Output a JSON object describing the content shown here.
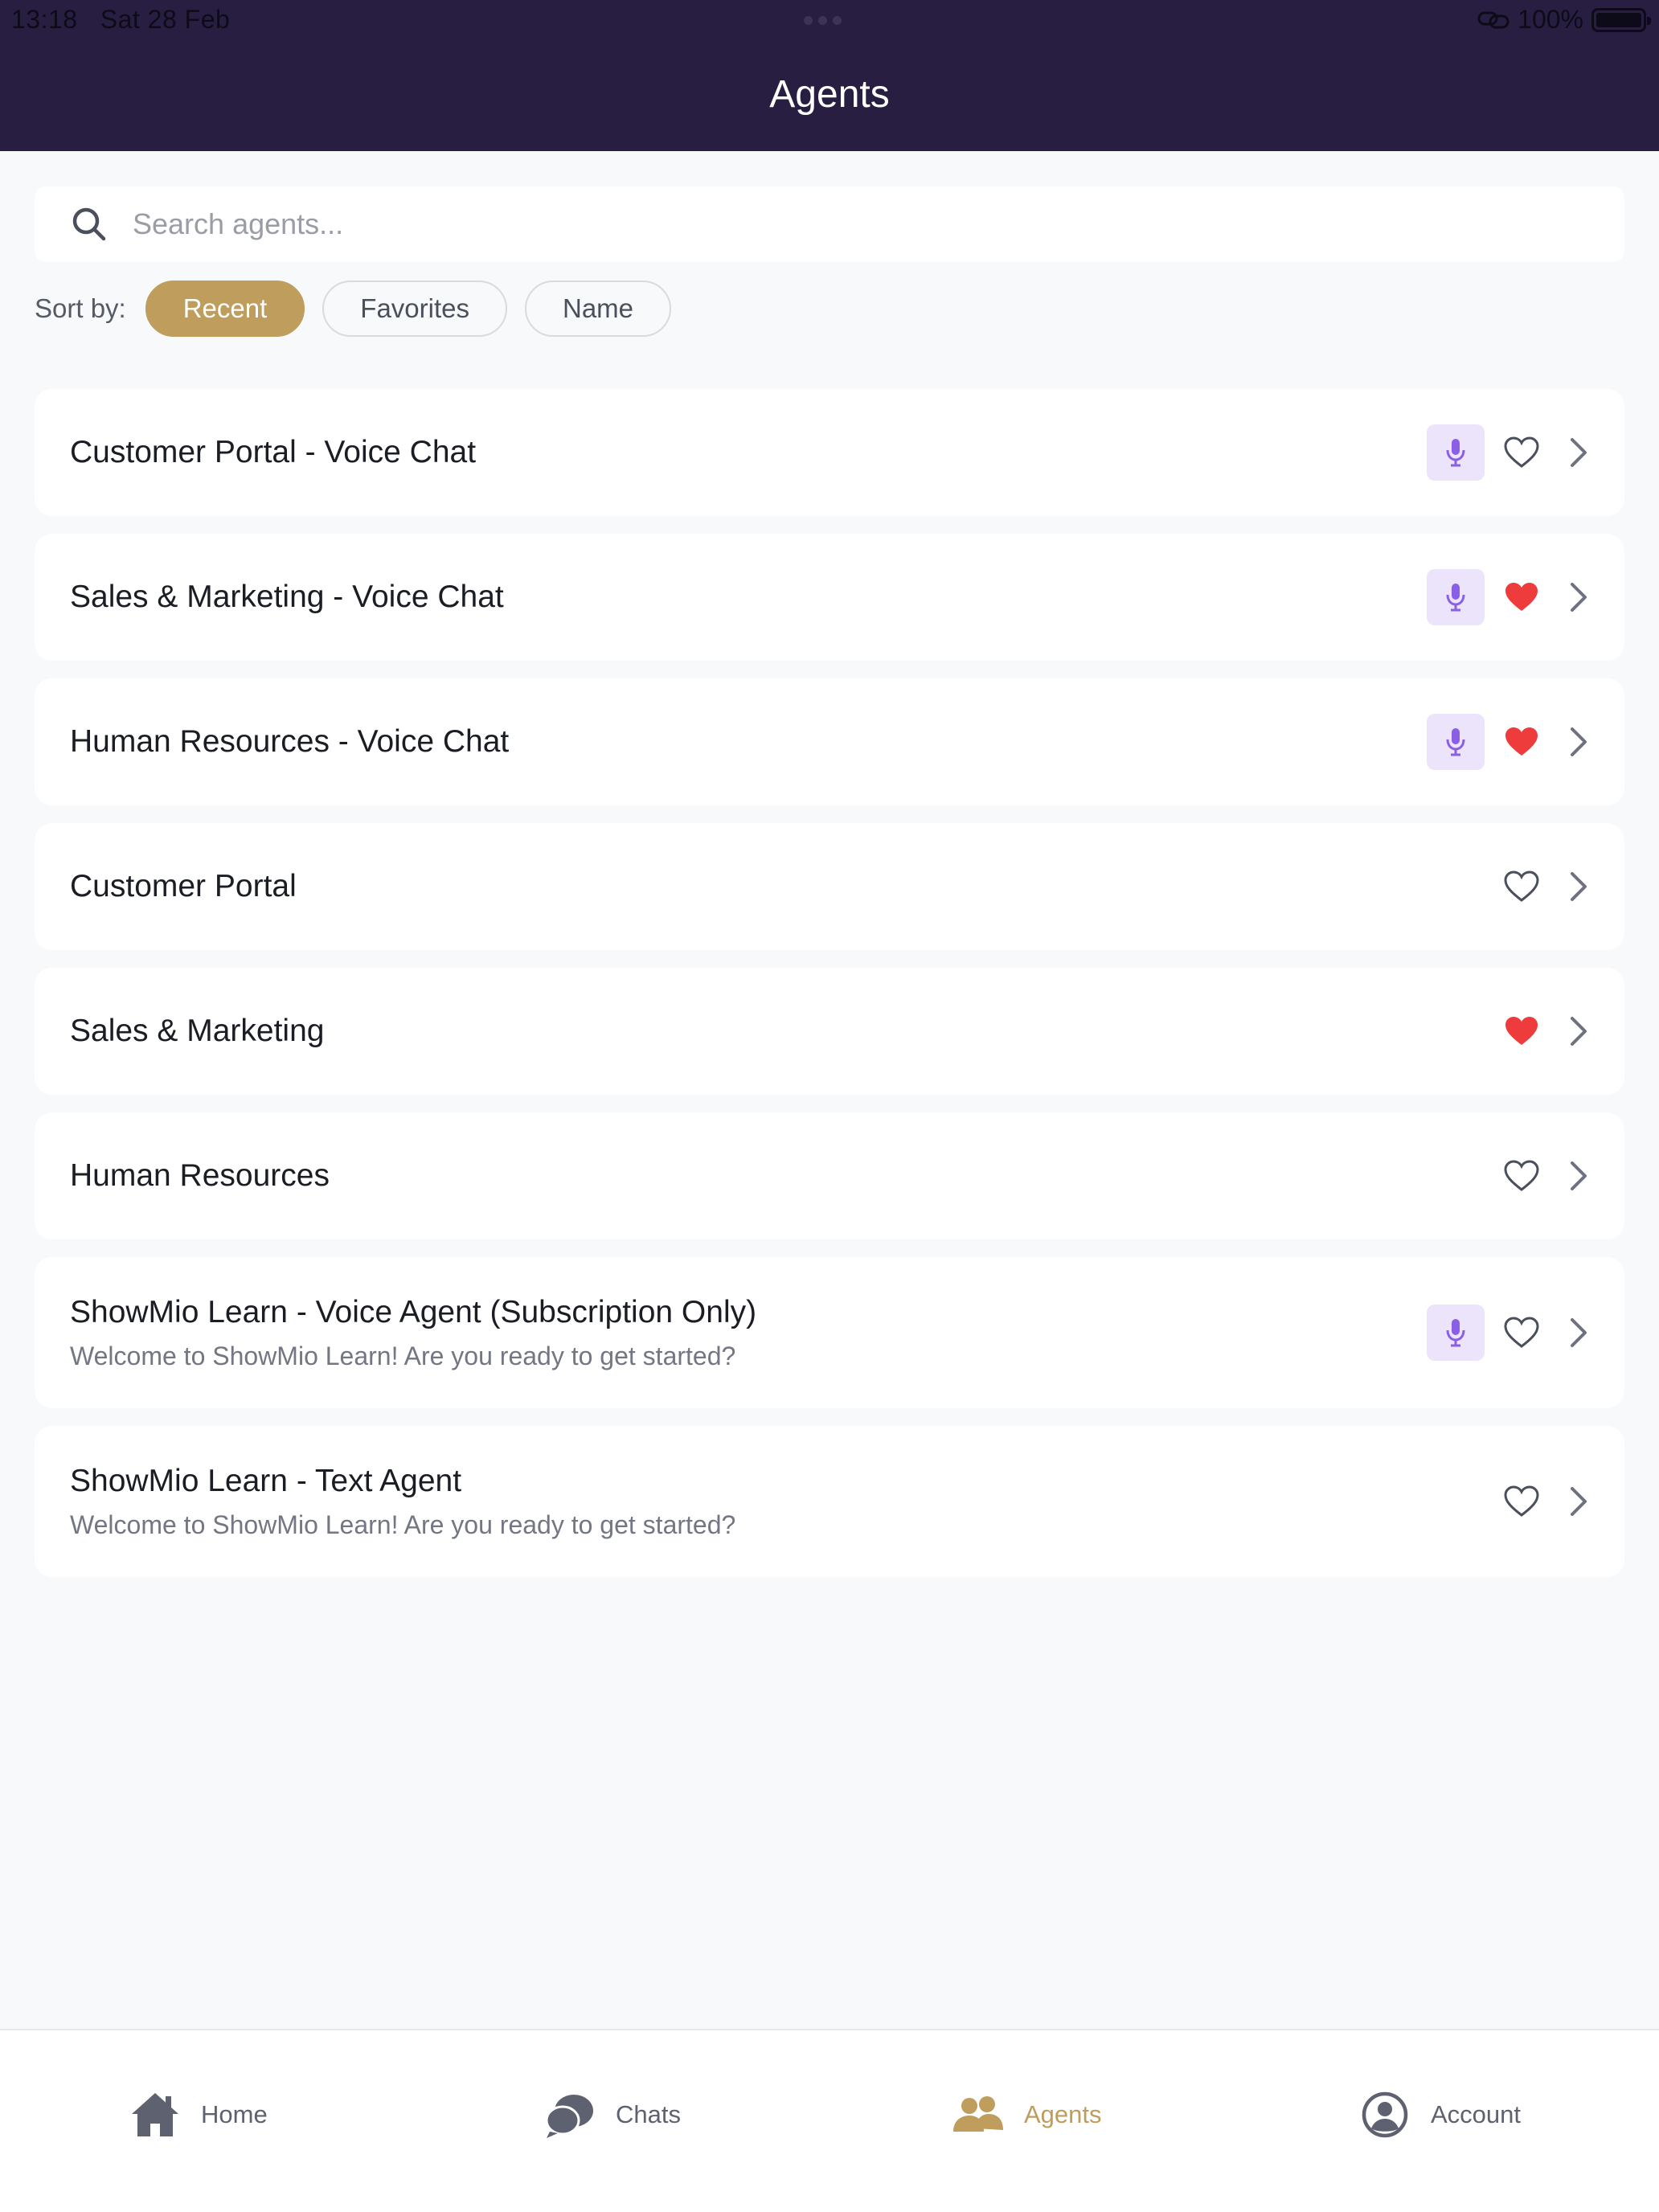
{
  "status_bar": {
    "time": "13:18",
    "date": "Sat 28 Feb",
    "battery": "100%"
  },
  "header": {
    "title": "Agents"
  },
  "search": {
    "placeholder": "Search agents..."
  },
  "sort": {
    "label": "Sort by:",
    "options": [
      "Recent",
      "Favorites",
      "Name"
    ],
    "selected": "Recent"
  },
  "agents": [
    {
      "title": "Customer Portal - Voice Chat",
      "subtitle": "",
      "voice": true,
      "favorite": false
    },
    {
      "title": "Sales & Marketing - Voice Chat",
      "subtitle": "",
      "voice": true,
      "favorite": true
    },
    {
      "title": "Human Resources - Voice Chat",
      "subtitle": "",
      "voice": true,
      "favorite": true
    },
    {
      "title": "Customer Portal",
      "subtitle": "",
      "voice": false,
      "favorite": false
    },
    {
      "title": "Sales & Marketing",
      "subtitle": "",
      "voice": false,
      "favorite": true
    },
    {
      "title": "Human Resources",
      "subtitle": "",
      "voice": false,
      "favorite": false
    },
    {
      "title": "ShowMio Learn - Voice Agent (Subscription Only)",
      "subtitle": "Welcome to ShowMio Learn! Are you ready to get started?",
      "voice": true,
      "favorite": false
    },
    {
      "title": "ShowMio Learn - Text Agent",
      "subtitle": "Welcome to ShowMio Learn! Are you ready to get started?",
      "voice": false,
      "favorite": false
    }
  ],
  "tabbar": {
    "items": [
      {
        "label": "Home",
        "icon": "home-icon"
      },
      {
        "label": "Chats",
        "icon": "chats-icon"
      },
      {
        "label": "Agents",
        "icon": "agents-icon"
      },
      {
        "label": "Account",
        "icon": "account-icon"
      }
    ],
    "active": "Agents"
  },
  "colors": {
    "header_bg": "#281e42",
    "accent_gold": "#bf9d5d",
    "favorite_red": "#ee3c3c",
    "mic_purple": "#8a5fe6",
    "mic_bg": "#ebe4fb"
  }
}
